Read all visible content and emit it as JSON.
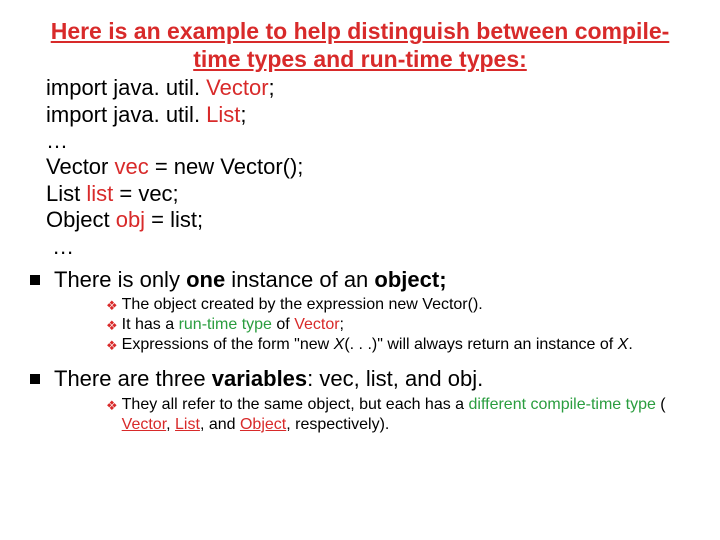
{
  "title": "Here is an example to help distinguish between compile-time types and run-time types:",
  "code": {
    "l1a": "import java. util. ",
    "l1b": "Vector",
    "l1c": ";",
    "l2a": "import java. util. ",
    "l2b": "List",
    "l2c": ";",
    "dots1": "…",
    "l3a": "Vector ",
    "l3b": "vec",
    "l3c": " = new Vector();",
    "l4a": "List ",
    "l4b": "list",
    "l4c": " = vec;",
    "l5a": "Object ",
    "l5b": "obj",
    "l5c": " = list;",
    "dots2": "…"
  },
  "bullets": {
    "b1a": "There is only ",
    "b1b": "one",
    "b1c": " instance of an ",
    "b1d": "object;",
    "s1a": "The object created by the expression new Vector().",
    "s2a": "It has a ",
    "s2b": "run-time type",
    "s2c": " of ",
    "s2d": "Vector",
    "s2e": ";",
    "s3a": "Expressions of the form \"new ",
    "s3b": "X",
    "s3c": "(. . .)\" will always return an instance of ",
    "s3d": "X",
    "s3e": ".",
    "b2a": "There are three ",
    "b2b": "variables",
    "b2c": ": vec, list, and obj.",
    "s4a": "They all refer to the same object, but each has a ",
    "s4b": "different compile-time type",
    "s4c": " ( ",
    "s4d": "Vector",
    "s4e": ", ",
    "s4f": "List",
    "s4g": ", and ",
    "s4h": "Object",
    "s4i": ", respectively)."
  }
}
